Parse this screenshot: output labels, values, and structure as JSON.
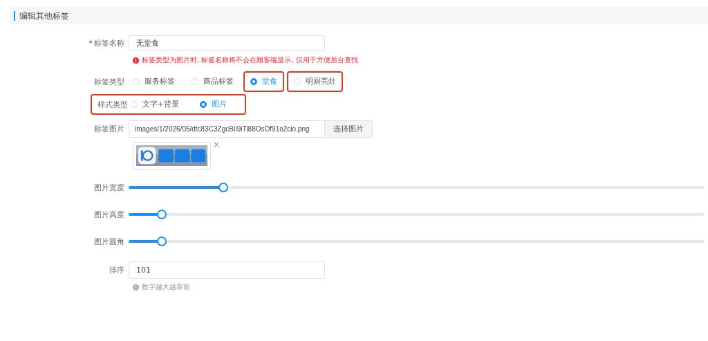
{
  "section": {
    "title": "编辑其他标签"
  },
  "name_field": {
    "label": "标签名称",
    "required_mark": "*",
    "value": "无堂食",
    "warning": "标签类型为图片时, 标签名称将不会在顾客端显示, 仅用于方便后台查找"
  },
  "tag_type": {
    "label": "标签类型",
    "options": [
      {
        "label": "服务标签",
        "selected": false,
        "highlighted": false
      },
      {
        "label": "商品标签",
        "selected": false,
        "highlighted": false
      },
      {
        "label": "堂食",
        "selected": true,
        "highlighted": true
      },
      {
        "label": "明厨亮灶",
        "selected": false,
        "highlighted": true
      }
    ]
  },
  "style_type": {
    "label": "样式类型",
    "highlighted": true,
    "options": [
      {
        "label": "文字+背景",
        "selected": false
      },
      {
        "label": "图片",
        "selected": true
      }
    ]
  },
  "image_field": {
    "label": "标签图片",
    "value": "images/1/2026/05/dtc83C3ZgcBIi9iTi88OsOf91o2cio.png",
    "button": "选择图片",
    "remove": "×"
  },
  "sliders": [
    {
      "label": "图片宽度",
      "level": 0.164
    },
    {
      "label": "图片高度",
      "level": 0.057
    },
    {
      "label": "图片圆角",
      "level": 0.057
    }
  ],
  "sort_field": {
    "label": "排序",
    "value": "101",
    "hint": "数字越大越靠前"
  }
}
